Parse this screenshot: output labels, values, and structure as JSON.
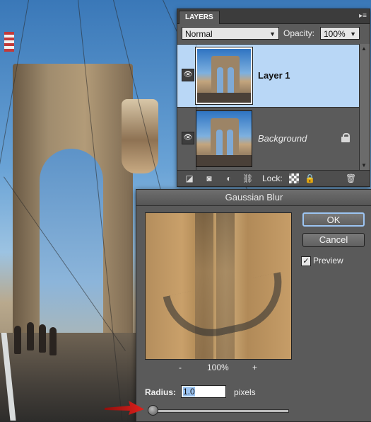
{
  "layers_panel": {
    "tab_label": "LAYERS",
    "blend_mode": "Normal",
    "opacity_label": "Opacity:",
    "opacity_value": "100%",
    "layers": [
      {
        "name": "Layer 1",
        "selected": true,
        "visible": true
      },
      {
        "name": "Background",
        "selected": false,
        "visible": true,
        "locked": true
      }
    ],
    "lock_label": "Lock:",
    "icons": [
      "link-layers-icon",
      "add-mask-icon",
      "adjustment-layer-icon",
      "link-icon",
      "lock-transparency-icon",
      "lock-icon",
      "trash-icon"
    ]
  },
  "gaussian_blur": {
    "title": "Gaussian Blur",
    "ok_label": "OK",
    "cancel_label": "Cancel",
    "preview_label": "Preview",
    "preview_checked": true,
    "zoom_minus": "-",
    "zoom_value": "100%",
    "zoom_plus": "+",
    "radius_label": "Radius:",
    "radius_value": "1.0",
    "radius_unit": "pixels",
    "slider_level": 0.0
  },
  "colors": {
    "selection_highlight": "#b9d7f6",
    "annotation_arrow": "#e0201c",
    "panel_bg": "#5b5b5b"
  }
}
